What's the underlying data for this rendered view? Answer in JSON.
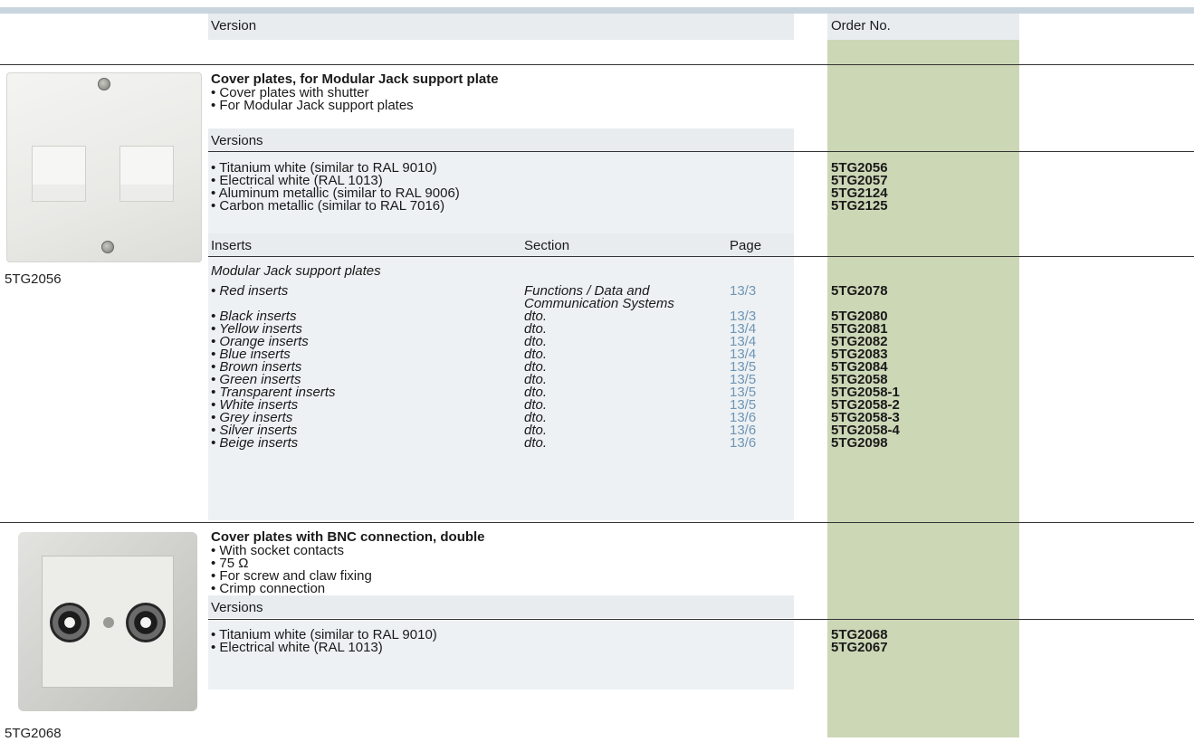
{
  "header": {
    "version": "Version",
    "order_no": "Order No."
  },
  "section1": {
    "title": "Cover plates, for Modular Jack support plate",
    "bullets": [
      "• Cover plates with shutter",
      "• For Modular Jack support plates"
    ],
    "versions_label": "Versions",
    "versions": [
      {
        "label": "• Titanium white (similar to RAL 9010)",
        "order": "5TG2056"
      },
      {
        "label": "• Electrical white (RAL 1013)",
        "order": "5TG2057"
      },
      {
        "label": "• Aluminum metallic (similar to RAL 9006)",
        "order": "5TG2124"
      },
      {
        "label": "• Carbon metallic (similar to RAL 7016)",
        "order": "5TG2125"
      }
    ],
    "inserts_header": {
      "inserts": "Inserts",
      "section": "Section",
      "page": "Page"
    },
    "inserts_intro": "Modular Jack support plates",
    "inserts": [
      {
        "label": "• Red inserts",
        "section": "Functions / Data and",
        "section2": "Communication Systems",
        "page": "13/3",
        "order": "5TG2078"
      },
      {
        "label": "• Black inserts",
        "section": "dto.",
        "page": "13/3",
        "order": "5TG2080"
      },
      {
        "label": "• Yellow inserts",
        "section": "dto.",
        "page": "13/4",
        "order": "5TG2081"
      },
      {
        "label": "• Orange inserts",
        "section": "dto.",
        "page": "13/4",
        "order": "5TG2082"
      },
      {
        "label": "• Blue inserts",
        "section": "dto.",
        "page": "13/4",
        "order": "5TG2083"
      },
      {
        "label": "• Brown inserts",
        "section": "dto.",
        "page": "13/5",
        "order": "5TG2084"
      },
      {
        "label": "• Green inserts",
        "section": "dto.",
        "page": "13/5",
        "order": "5TG2058"
      },
      {
        "label": "• Transparent inserts",
        "section": "dto.",
        "page": "13/5",
        "order": "5TG2058-1"
      },
      {
        "label": "• White inserts",
        "section": "dto.",
        "page": "13/5",
        "order": "5TG2058-2"
      },
      {
        "label": "• Grey inserts",
        "section": "dto.",
        "page": "13/6",
        "order": "5TG2058-3"
      },
      {
        "label": "• Silver inserts",
        "section": "dto.",
        "page": "13/6",
        "order": "5TG2058-4"
      },
      {
        "label": "• Beige inserts",
        "section": "dto.",
        "page": "13/6",
        "order": "5TG2098"
      }
    ],
    "image_caption": "5TG2056"
  },
  "section2": {
    "title": "Cover plates with BNC connection, double",
    "bullets": [
      "• With socket contacts",
      "• 75 Ω",
      "• For screw and claw fixing",
      "• Crimp connection"
    ],
    "versions_label": "Versions",
    "versions": [
      {
        "label": "• Titanium white (similar to RAL 9010)",
        "order": "5TG2068"
      },
      {
        "label": "• Electrical white (RAL 1013)",
        "order": "5TG2067"
      }
    ],
    "image_caption": "5TG2068"
  },
  "colors": {
    "order_column": "#ccd7b6",
    "header_band": "#e8ecef",
    "page_link": "#6f95b5"
  }
}
